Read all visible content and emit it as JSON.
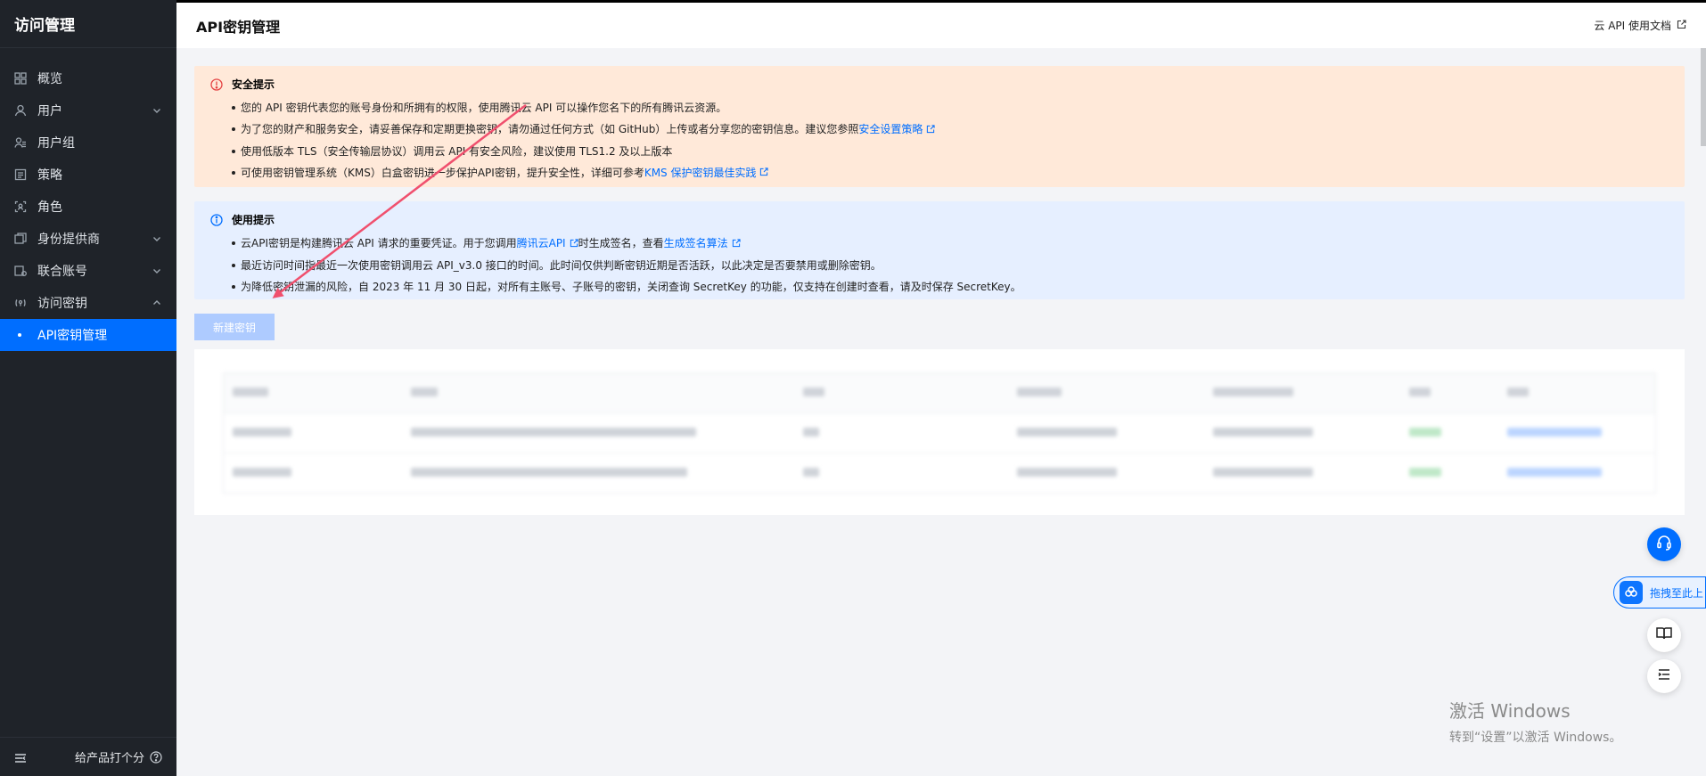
{
  "sidebar": {
    "brand": "访问管理",
    "items": [
      {
        "label": "概览",
        "icon": "grid-icon"
      },
      {
        "label": "用户",
        "icon": "user-icon"
      },
      {
        "label": "用户组",
        "icon": "users-icon"
      },
      {
        "label": "策略",
        "icon": "policy-icon"
      },
      {
        "label": "角色",
        "icon": "role-icon"
      },
      {
        "label": "身份提供商",
        "icon": "idp-icon"
      },
      {
        "label": "联合账号",
        "icon": "federation-icon"
      },
      {
        "label": "访问密钥",
        "icon": "key-icon"
      }
    ],
    "sub_active": "API密钥管理",
    "footer_rate": "给产品打个分"
  },
  "header": {
    "title": "API密钥管理",
    "doc_link": "云 API 使用文档"
  },
  "security_notice": {
    "title": "安全提示",
    "items": [
      {
        "text": "您的 API 密钥代表您的账号身份和所拥有的权限，使用腾讯云 API 可以操作您名下的所有腾讯云资源。"
      },
      {
        "text": "为了您的财产和服务安全，请妥善保存和定期更换密钥，请勿通过任何方式（如 GitHub）上传或者分享您的密钥信息。建议您参照",
        "link": "安全设置策略"
      },
      {
        "text": "使用低版本 TLS（安全传输层协议）调用云 API 有安全风险，建议使用 TLS1.2 及以上版本"
      },
      {
        "text": "可使用密钥管理系统（KMS）白盒密钥进一步保护API密钥，提升安全性，详细可参考",
        "link": "KMS 保护密钥最佳实践"
      }
    ]
  },
  "usage_notice": {
    "title": "使用提示",
    "items": [
      {
        "text_pre": "云API密钥是构建腾讯云 API 请求的重要凭证。用于您调用",
        "link1": "腾讯云API",
        "text_mid": "时生成签名，查看",
        "link2": "生成签名算法"
      },
      {
        "text_pre": "最近访问时间指最近一次使用密钥调用云 API_v3.0 接口的时间。此时间仅供判断密钥近期是否活跃，以此决定是否要禁用或删除密钥。"
      },
      {
        "text_pre": "为降低密钥泄漏的风险，自 2023 年 11 月 30 日起，对所有主账号、子账号的密钥，关闭查询 SecretKey 的功能，仅支持在创建时查看，请及时保存 SecretKey。"
      }
    ]
  },
  "create_button": "新建密钥",
  "floating": {
    "drag_text": "拖拽至此上"
  },
  "watermark": {
    "line1": "激活 Windows",
    "line2": "转到“设置”以激活 Windows。"
  },
  "colors": {
    "accent": "#006eff",
    "sidebar_bg": "#1f2329",
    "warn_bg": "#ffe9d9",
    "info_bg": "#e6efff",
    "arrow": "#f0506e"
  }
}
